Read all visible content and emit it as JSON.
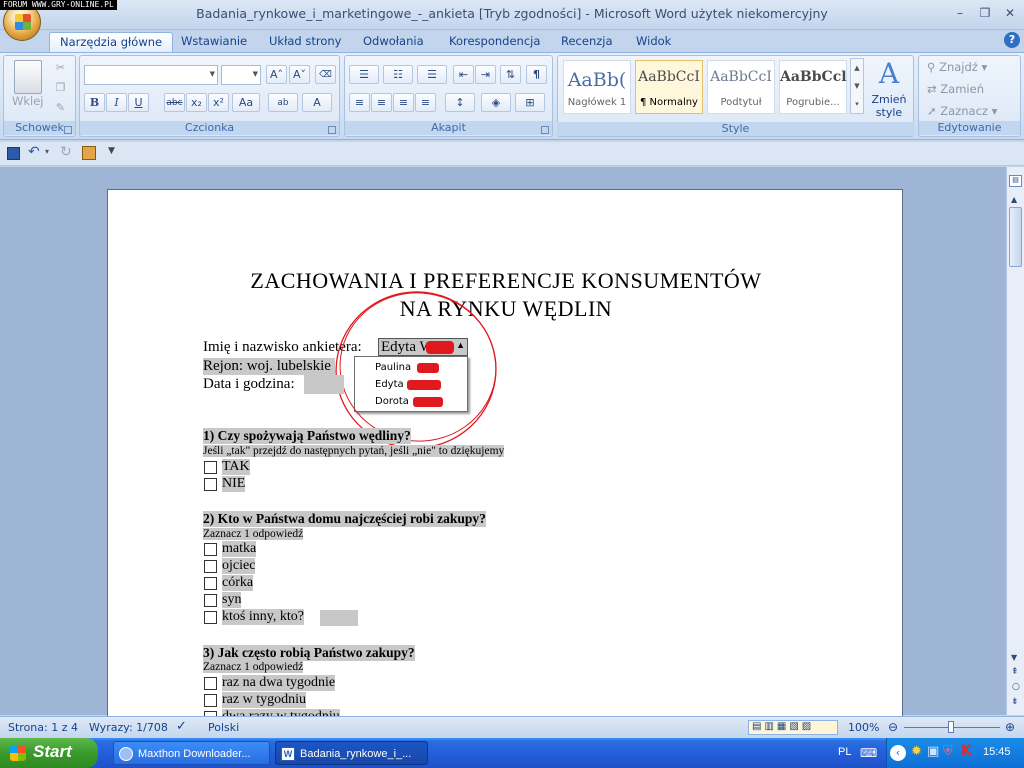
{
  "watermark": "FORUM WWW.GRY-ONLINE.PL",
  "window": {
    "title": "Badania_rynkowe_i_marketingowe_-_ankieta [Tryb zgodności] - Microsoft Word użytek niekomercyjny",
    "minimize": "–",
    "restore": "❐",
    "close": "✕"
  },
  "tabs": [
    "Narzędzia główne",
    "Wstawianie",
    "Układ strony",
    "Odwołania",
    "Korespondencja",
    "Recenzja",
    "Widok"
  ],
  "help": "?",
  "ribbon": {
    "clipboard": {
      "label": "Schowek",
      "paste": "Wklej"
    },
    "font": {
      "label": "Czcionka",
      "font_name": "",
      "font_size": "",
      "bold": "B",
      "italic": "I",
      "underline": "U",
      "strike": "abc",
      "subscript": "x₂",
      "superscript": "x²",
      "change_case": "Aa",
      "grow": "A˄",
      "shrink": "A˅",
      "font_color": "A",
      "highlight": "ab"
    },
    "paragraph": {
      "label": "Akapit",
      "pilcrow": "¶"
    },
    "styles": {
      "label": "Style",
      "items": [
        {
          "preview": "AaBb(",
          "name": "Nagłówek 1"
        },
        {
          "preview": "AaBbCcI",
          "name": "¶ Normalny"
        },
        {
          "preview": "AaBbCcI",
          "name": "Podtytuł"
        },
        {
          "preview": "AaBbCcl",
          "name": "Pogrubie..."
        }
      ],
      "change_styles": "Zmień style"
    },
    "editing": {
      "label": "Edytowanie",
      "find": "Znajdź",
      "replace": "Zamień",
      "select": "Zaznacz"
    }
  },
  "document": {
    "title_line1": "ZACHOWANIA  I  PREFERENCJE  KONSUMENTÓW",
    "title_line2": "NA  RYNKU  WĘDLIN",
    "interviewer_label": "Imię i nazwisko ankietera:",
    "interviewer_value": "Edyta W",
    "dropdown_options": [
      "Paulina",
      "Edyta",
      "Dorota"
    ],
    "region_label": "Rejon: woj. lubelskie",
    "datetime_label": "Data i godzina:",
    "q1": {
      "title": "1) Czy spożywają Państwo wędliny?",
      "note": "Jeśli „tak\" przejdź do następnych pytań, jeśli „nie\" to dziękujemy",
      "options": [
        "TAK",
        "NIE"
      ]
    },
    "q2": {
      "title": "2) Kto w Państwa domu najczęściej robi zakupy?",
      "note": "Zaznacz 1 odpowiedź",
      "options": [
        "matka",
        "ojciec",
        "córka",
        "syn",
        "ktoś inny, kto?"
      ]
    },
    "q3": {
      "title": "3) Jak często robią Państwo zakupy?",
      "note": "Zaznacz 1 odpowiedź",
      "options": [
        "raz na dwa tygodnie",
        "raz w tygodniu",
        "dwa razy w tygodniu"
      ]
    }
  },
  "status": {
    "page": "Strona: 1 z 4",
    "words": "Wyrazy: 1/708",
    "language": "Polski",
    "zoom": "100%"
  },
  "taskbar": {
    "start": "Start",
    "tasks": [
      "Maxthon Downloader...",
      "Badania_rynkowe_i_..."
    ],
    "lang": "PL",
    "clock": "15:45"
  }
}
